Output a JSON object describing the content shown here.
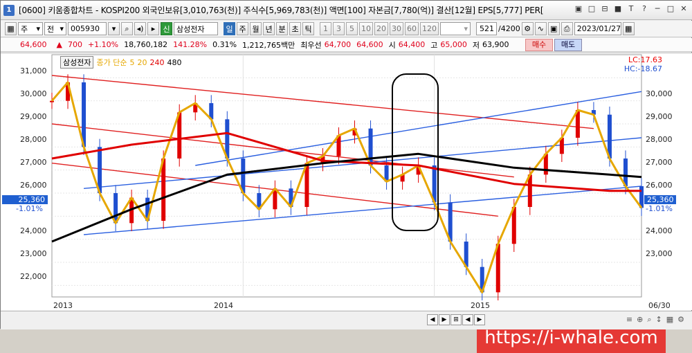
{
  "window": {
    "title": "[0600] 키움종합차트 - KOSPI200 외국인보유[3,010,763(천)] 주식수[5,969,783(천)] 액면[100] 자본금[7,780(억)] 결산[12월] EPS[5,777] PER[",
    "app_icon": "1",
    "controls": [
      "▣",
      "□",
      "⊟",
      "■",
      "T",
      "?",
      "─",
      "□",
      "✕"
    ]
  },
  "toolbar": {
    "market_label": "주",
    "mode_label": "전",
    "stock_code": "005930",
    "stock_name": "삼성전자",
    "period_buttons": [
      "일",
      "주",
      "월",
      "년",
      "분",
      "초",
      "틱"
    ],
    "minute_buttons": [
      "1",
      "3",
      "5",
      "10",
      "20",
      "30",
      "60",
      "120"
    ],
    "count_value": "521",
    "count_total": "/4200",
    "date_value": "2023/01/27",
    "shin_label": "신"
  },
  "quote": {
    "price": "64,600",
    "change": "700",
    "change_pct": "+1.10%",
    "volume": "18,760,182",
    "volume_ratio": "141.28%",
    "turnover": "0.31%",
    "amount": "1,212,765백만",
    "best_ask_label": "최우선",
    "best_ask": "64,700",
    "best_bid": "64,600",
    "open_label": "시",
    "open": "64,400",
    "high_label": "고",
    "high": "65,000",
    "low_label": "저",
    "low": "63,900",
    "buy_label": "매수",
    "sell_label": "매도"
  },
  "chart": {
    "stock_label": "삼성전자",
    "legend_text": "종가 단순",
    "ma_periods": [
      "5",
      "20",
      "240",
      "480"
    ],
    "ma_colors": [
      "#e6a700",
      "#e6a700",
      "#e00000",
      "#000000"
    ],
    "lc_label": "LC:17.63",
    "hc_label": "HC:-18.67",
    "last_price": "25,360",
    "last_pct": "-1.01%",
    "y_ticks": [
      "31,000",
      "30,000",
      "29,000",
      "28,000",
      "27,000",
      "26,000",
      "25,000",
      "24,000",
      "23,000",
      "22,000"
    ],
    "x_ticks": [
      "2013",
      "2014",
      "2015",
      "06/30"
    ],
    "watermark": "https://i-whale.com",
    "candle_up_color": "#e00000",
    "candle_down_color": "#1f4fd0"
  },
  "bottom": {
    "nav": [
      "◀",
      "▶",
      "⊞",
      "◀",
      "▶"
    ],
    "icons": [
      "≡",
      "⊕",
      "⌕",
      "↕",
      "▦",
      "⚙"
    ]
  },
  "chart_data": {
    "type": "line",
    "series": [
      {
        "name": "종가",
        "points": [
          [
            "2013-01",
            30000
          ],
          [
            "2013-02",
            30800
          ],
          [
            "2013-03",
            28000
          ],
          [
            "2013-04",
            26000
          ],
          [
            "2013-05",
            24700
          ],
          [
            "2013-06",
            25800
          ],
          [
            "2013-07",
            24800
          ],
          [
            "2013-08",
            27500
          ],
          [
            "2013-09",
            29500
          ],
          [
            "2013-10",
            29900
          ],
          [
            "2013-11",
            29200
          ],
          [
            "2013-12",
            27500
          ],
          [
            "2014-01",
            26000
          ],
          [
            "2014-02",
            25300
          ],
          [
            "2014-03",
            26200
          ],
          [
            "2014-04",
            25400
          ],
          [
            "2014-05",
            27300
          ],
          [
            "2014-06",
            27600
          ],
          [
            "2014-07",
            28500
          ],
          [
            "2014-08",
            28800
          ],
          [
            "2014-09",
            27200
          ],
          [
            "2014-10",
            26500
          ],
          [
            "2014-11",
            26800
          ],
          [
            "2014-12",
            27200
          ],
          [
            "2015-01",
            25600
          ],
          [
            "2015-02",
            23900
          ],
          [
            "2015-03",
            22800
          ],
          [
            "2015-04",
            21700
          ],
          [
            "2015-05",
            23800
          ],
          [
            "2015-06",
            25400
          ],
          [
            "2015-07",
            26800
          ],
          [
            "2015-08",
            27700
          ],
          [
            "2015-09",
            28400
          ],
          [
            "2015-10",
            29600
          ],
          [
            "2015-11",
            29400
          ],
          [
            "2015-12",
            27500
          ],
          [
            "2016-01",
            26300
          ],
          [
            "2016-02",
            25360
          ]
        ]
      },
      {
        "name": "240",
        "points": [
          [
            "2013-01",
            27500
          ],
          [
            "2013-06",
            28100
          ],
          [
            "2013-12",
            28600
          ],
          [
            "2014-06",
            27400
          ],
          [
            "2014-12",
            27200
          ],
          [
            "2015-06",
            26400
          ],
          [
            "2015-12",
            26100
          ],
          [
            "2016-02",
            26100
          ]
        ]
      },
      {
        "name": "480",
        "points": [
          [
            "2013-01",
            23900
          ],
          [
            "2013-06",
            25300
          ],
          [
            "2013-12",
            26800
          ],
          [
            "2014-06",
            27300
          ],
          [
            "2014-12",
            27700
          ],
          [
            "2015-06",
            27100
          ],
          [
            "2015-12",
            26800
          ],
          [
            "2016-02",
            26700
          ]
        ]
      }
    ],
    "ylim": [
      21500,
      31400
    ],
    "y_scale": "linear"
  }
}
